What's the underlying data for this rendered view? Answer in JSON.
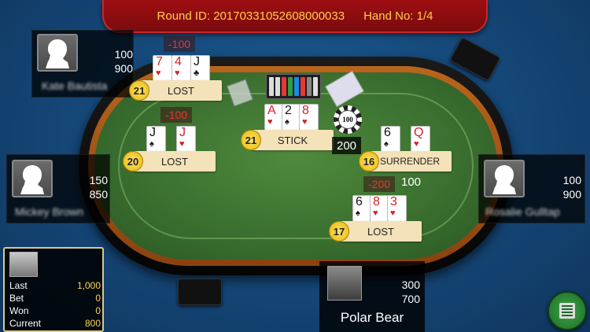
{
  "header": {
    "round_label": "Round ID: 20170331052608000033",
    "hand_label": "Hand No: 1/4"
  },
  "players": {
    "top_left": {
      "name": "Kate Bautista",
      "bet": "100",
      "balance": "900"
    },
    "left": {
      "name": "Mickey Brown",
      "bet": "150",
      "balance": "850"
    },
    "right": {
      "name": "Rosalie Gulltap",
      "bet": "100",
      "balance": "900"
    },
    "me": {
      "name": "Polar Bear",
      "bet": "300",
      "balance": "700"
    }
  },
  "hands": {
    "h1": {
      "cards": [
        {
          "r": "7",
          "s": "♥",
          "c": "red"
        },
        {
          "r": "4",
          "s": "♥",
          "c": "red"
        },
        {
          "r": "J",
          "s": "♣",
          "c": "blk"
        }
      ],
      "score": "21",
      "status": "LOST",
      "result": "-100"
    },
    "h2": {
      "cards": [
        {
          "r": "J",
          "s": "♠",
          "c": "blk"
        },
        {
          "r": "J",
          "s": "♥",
          "c": "red"
        }
      ],
      "score": "20",
      "status": "LOST",
      "result": "-100"
    },
    "h3": {
      "cards": [
        {
          "r": "A",
          "s": "♥",
          "c": "red"
        },
        {
          "r": "2",
          "s": "♠",
          "c": "blk"
        },
        {
          "r": "8",
          "s": "♥",
          "c": "red"
        }
      ],
      "score": "21",
      "status": "STICK",
      "bet": "200"
    },
    "h4": {
      "cards": [
        {
          "r": "6",
          "s": "♠",
          "c": "blk"
        },
        {
          "r": "Q",
          "s": "♥",
          "c": "red"
        }
      ],
      "score": "16",
      "status": "SURRENDER",
      "result": "-200",
      "bet": "100"
    },
    "h5": {
      "cards": [
        {
          "r": "6",
          "s": "♠",
          "c": "blk"
        },
        {
          "r": "8",
          "s": "♥",
          "c": "red"
        },
        {
          "r": "3",
          "s": "♥",
          "c": "red"
        }
      ],
      "score": "17",
      "status": "LOST"
    }
  },
  "chip": {
    "value": "100"
  },
  "stats": {
    "last_label": "Last",
    "last_value": "1,000",
    "bet_label": "Bet",
    "bet_value": "0",
    "won_label": "Won",
    "won_value": "0",
    "current_label": "Current",
    "current_value": "800"
  },
  "icons": {
    "avatar": "person-silhouette-icon",
    "menu": "menu-list-icon"
  },
  "colors": {
    "banner": "#9e0f12",
    "banner_text": "#ffcf4a",
    "felt": "#3b7030",
    "loss": "#e53935",
    "score_chip": "#ffe26a"
  }
}
